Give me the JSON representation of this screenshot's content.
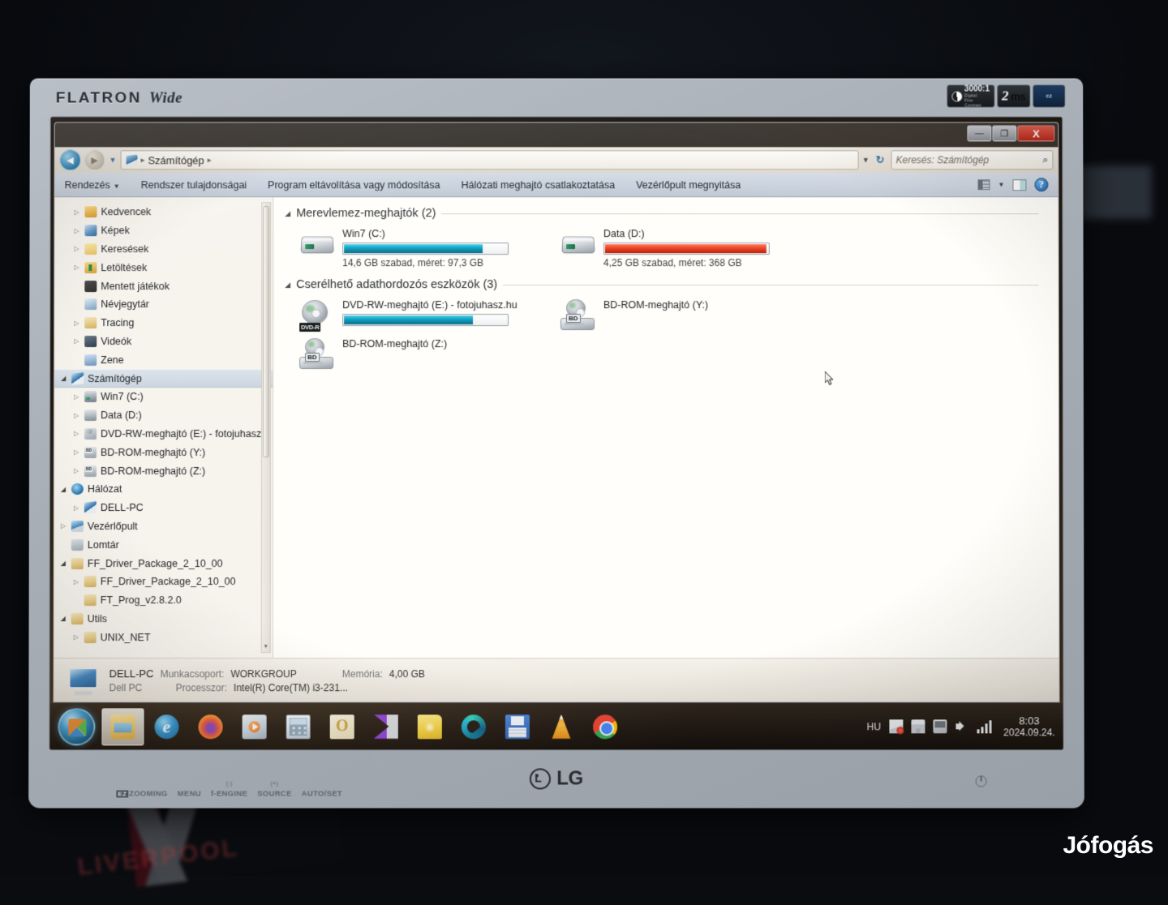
{
  "monitor": {
    "brand_logo": "FLATRON",
    "brand_logo_sub": "Wide",
    "vendor": "LG",
    "sticker_contrast": "3000:1",
    "sticker_contrast_sub1": "Digital",
    "sticker_contrast_sub2": "Fine",
    "sticker_contrast_sub3": "Contrast",
    "sticker_response": "2",
    "sticker_response_unit": "ms",
    "sticker_third": "ez",
    "osd_buttons": [
      {
        "label": "ZOOMING",
        "badge": "EZ",
        "sup": ""
      },
      {
        "label": "MENU",
        "badge": "",
        "sup": ""
      },
      {
        "label": "f-ENGINE",
        "badge": "",
        "sup": "(-)"
      },
      {
        "label": "SOURCE",
        "badge": "",
        "sup": "(+)"
      },
      {
        "label": "AUTO/SET",
        "badge": "",
        "sup": ""
      }
    ]
  },
  "watermark": "Jófogás",
  "flag_text": "LIVERPOOL",
  "window": {
    "minimize_label": "—",
    "maximize_label": "❐",
    "close_label": "X"
  },
  "address": {
    "back_label": "◄",
    "forward_label": "►",
    "history_label": "▼",
    "breadcrumb_root": "Számítógép",
    "separator": "▸",
    "dropdown_label": "▼",
    "refresh_label": "↻"
  },
  "search": {
    "placeholder": "Keresés: Számítógép",
    "icon_label": "⌕"
  },
  "commandbar": {
    "items": [
      {
        "label": "Rendezés",
        "caret": "▼"
      },
      {
        "label": "Rendszer tulajdonságai",
        "caret": ""
      },
      {
        "label": "Program eltávolítása vagy módosítása",
        "caret": ""
      },
      {
        "label": "Hálózati meghajtó csatlakoztatása",
        "caret": ""
      },
      {
        "label": "Vezérlőpult megnyitása",
        "caret": ""
      }
    ],
    "view_caret": "▼"
  },
  "navpane": {
    "scroll_up": "▲",
    "scroll_down": "▼",
    "items": [
      {
        "label": "Kedvencek",
        "indent": 1,
        "twisty": "▷",
        "icon": "ic-folder"
      },
      {
        "label": "Képek",
        "indent": 1,
        "twisty": "▷",
        "icon": "ic-pic"
      },
      {
        "label": "Keresések",
        "indent": 1,
        "twisty": "▷",
        "icon": "ic-search"
      },
      {
        "label": "Letöltések",
        "indent": 1,
        "twisty": "▷",
        "icon": "ic-dl"
      },
      {
        "label": "Mentett játékok",
        "indent": 1,
        "twisty": "",
        "icon": "ic-games"
      },
      {
        "label": "Névjegytár",
        "indent": 1,
        "twisty": "",
        "icon": "ic-contact"
      },
      {
        "label": "Tracing",
        "indent": 1,
        "twisty": "▷",
        "icon": "ic-folder-pale"
      },
      {
        "label": "Videók",
        "indent": 1,
        "twisty": "▷",
        "icon": "ic-video"
      },
      {
        "label": "Zene",
        "indent": 1,
        "twisty": "",
        "icon": "ic-music"
      },
      {
        "label": "Számítógép",
        "indent": 0,
        "twisty": "◢",
        "icon": "ic-pc",
        "selected": true
      },
      {
        "label": "Win7 (C:)",
        "indent": 1,
        "twisty": "▷",
        "icon": "ic-hdd"
      },
      {
        "label": "Data (D:)",
        "indent": 1,
        "twisty": "▷",
        "icon": "ic-hdd2"
      },
      {
        "label": "DVD-RW-meghajtó (E:) - fotojuhasz.",
        "indent": 1,
        "twisty": "▷",
        "icon": "ic-dvd"
      },
      {
        "label": "BD-ROM-meghajtó (Y:)",
        "indent": 1,
        "twisty": "▷",
        "icon": "ic-bd"
      },
      {
        "label": "BD-ROM-meghajtó (Z:)",
        "indent": 1,
        "twisty": "▷",
        "icon": "ic-bd"
      },
      {
        "label": "Hálózat",
        "indent": 0,
        "twisty": "◢",
        "icon": "ic-net"
      },
      {
        "label": "DELL-PC",
        "indent": 1,
        "twisty": "▷",
        "icon": "ic-pc"
      },
      {
        "label": "Vezérlőpult",
        "indent": 0,
        "twisty": "▷",
        "icon": "ic-cpl"
      },
      {
        "label": "Lomtár",
        "indent": 0,
        "twisty": "",
        "icon": "ic-bin"
      },
      {
        "label": "FF_Driver_Package_2_10_00",
        "indent": 0,
        "twisty": "◢",
        "icon": "ic-folder-pale"
      },
      {
        "label": "FF_Driver_Package_2_10_00",
        "indent": 1,
        "twisty": "▷",
        "icon": "ic-folder-pale"
      },
      {
        "label": "FT_Prog_v2.8.2.0",
        "indent": 1,
        "twisty": "",
        "icon": "ic-folder-pale"
      },
      {
        "label": "Utils",
        "indent": 0,
        "twisty": "◢",
        "icon": "ic-folder-pale"
      },
      {
        "label": "UNIX_NET",
        "indent": 1,
        "twisty": "▷",
        "icon": "ic-folder-pale"
      }
    ]
  },
  "content": {
    "groups": [
      {
        "title": "Merevlemez-meghajtók (2)",
        "caret": "◢",
        "drives": [
          {
            "name": "Win7 (C:)",
            "sub": "14,6 GB szabad, méret: 97,3 GB",
            "icon": "hdd",
            "has_bar": true,
            "fill_percent": 85,
            "bar_color": "teal"
          },
          {
            "name": "Data (D:)",
            "sub": "4,25 GB szabad, méret: 368 GB",
            "icon": "hdd",
            "has_bar": true,
            "fill_percent": 99,
            "bar_color": "red"
          }
        ]
      },
      {
        "title": "Cserélhető adathordozós eszközök (3)",
        "caret": "◢",
        "drives": [
          {
            "name": "DVD-RW-meghajtó (E:) - fotojuhasz.hu",
            "sub": "",
            "icon": "dvd",
            "badge": "DVD-R",
            "has_bar": true,
            "fill_percent": 79,
            "bar_color": "teal"
          },
          {
            "name": "BD-ROM-meghajtó (Y:)",
            "sub": "",
            "icon": "bd",
            "badge": "BD",
            "has_bar": false,
            "fill_percent": 0,
            "bar_color": ""
          },
          {
            "name": "BD-ROM-meghajtó (Z:)",
            "sub": "",
            "icon": "bd",
            "badge": "BD",
            "has_bar": false,
            "fill_percent": 0,
            "bar_color": ""
          }
        ]
      }
    ]
  },
  "statusbar": {
    "computer_name": "DELL-PC",
    "workgroup_label": "Munkacsoport:",
    "workgroup_value": "WORKGROUP",
    "memory_label": "Memória:",
    "memory_value": "4,00 GB",
    "model": "Dell PC",
    "cpu_label": "Processzor:",
    "cpu_value": "Intel(R) Core(TM) i3-231..."
  },
  "taskbar": {
    "start_label": "Start",
    "items": [
      {
        "name": "explorer",
        "icon": "ico-explorer",
        "active": true
      },
      {
        "name": "internet-explorer",
        "icon": "ico-ie",
        "active": false
      },
      {
        "name": "firefox",
        "icon": "ico-ff",
        "active": false
      },
      {
        "name": "media-player",
        "icon": "ico-wmp",
        "active": false
      },
      {
        "name": "calculator",
        "icon": "ico-calc",
        "active": false
      },
      {
        "name": "office",
        "icon": "ico-office",
        "active": false
      },
      {
        "name": "video-player",
        "icon": "ico-purple",
        "active": false
      },
      {
        "name": "note",
        "icon": "ico-note",
        "active": false
      },
      {
        "name": "edge",
        "icon": "ico-edge",
        "active": false
      },
      {
        "name": "save",
        "icon": "ico-floppy",
        "active": false
      },
      {
        "name": "vlc",
        "icon": "ico-vlc",
        "active": false
      },
      {
        "name": "chrome",
        "icon": "ico-chrome",
        "active": false
      }
    ],
    "tray": {
      "language": "HU",
      "icons": [
        "flag-icon",
        "usb-eject-icon",
        "display-icon",
        "speaker-icon",
        "signal-bars-icon"
      ],
      "time": "8:03",
      "date": "2024.09.24."
    }
  },
  "colors": {
    "bar_teal": "#12a7c4",
    "bar_red": "#f04a2c",
    "accent_blue": "#1358a3",
    "close_red": "#b6241a"
  }
}
